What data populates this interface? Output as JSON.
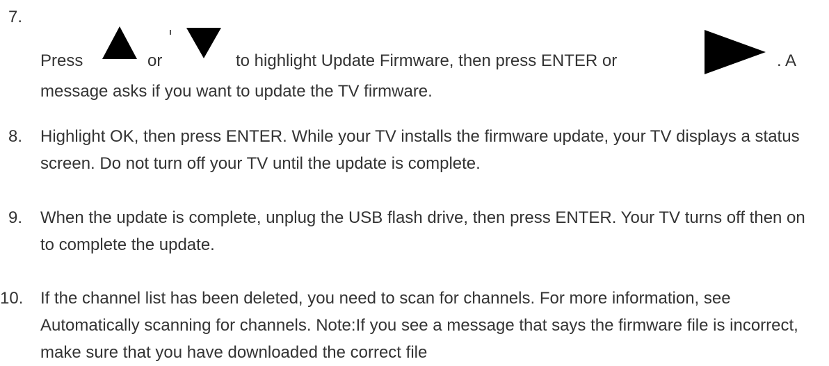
{
  "steps": [
    {
      "number": "7.",
      "parts": [
        "Press",
        "or",
        "to highlight Update Firmware, then press ENTER or",
        ". A"
      ],
      "line2": "message asks if you want to update the TV firmware.",
      "icons": [
        "up-arrow-icon",
        "down-arrow-icon",
        "right-arrow-icon"
      ]
    },
    {
      "number": "8.",
      "text": "Highlight OK, then press ENTER. While your TV installs the firmware update, your TV displays a status screen. Do not turn off your TV until the update is complete."
    },
    {
      "number": "9.",
      "text": "When the update is complete, unplug the USB flash drive, then press ENTER. Your TV turns off then on to complete the update."
    },
    {
      "number": "10.",
      "text": "If the channel list has been deleted, you need to scan for channels. For more information, see Automatically scanning for channels. Note:If you see a message that says the firmware file is incorrect, make sure that you have downloaded the correct file"
    }
  ]
}
